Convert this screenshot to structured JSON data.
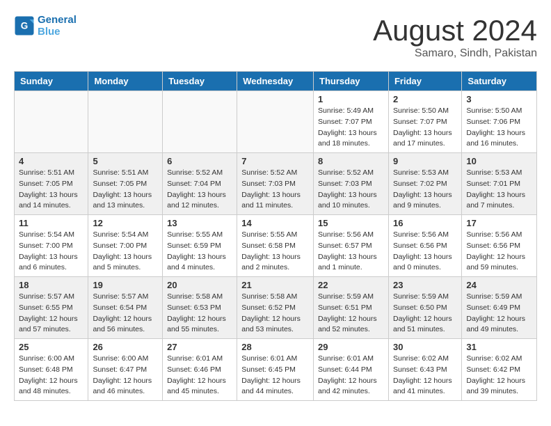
{
  "header": {
    "logo_line1": "General",
    "logo_line2": "Blue",
    "month_title": "August 2024",
    "location": "Samaro, Sindh, Pakistan"
  },
  "weekdays": [
    "Sunday",
    "Monday",
    "Tuesday",
    "Wednesday",
    "Thursday",
    "Friday",
    "Saturday"
  ],
  "weeks": [
    [
      {
        "day": "",
        "empty": true
      },
      {
        "day": "",
        "empty": true
      },
      {
        "day": "",
        "empty": true
      },
      {
        "day": "",
        "empty": true
      },
      {
        "day": "1",
        "sunrise": "5:49 AM",
        "sunset": "7:07 PM",
        "daylight": "13 hours and 18 minutes."
      },
      {
        "day": "2",
        "sunrise": "5:50 AM",
        "sunset": "7:07 PM",
        "daylight": "13 hours and 17 minutes."
      },
      {
        "day": "3",
        "sunrise": "5:50 AM",
        "sunset": "7:06 PM",
        "daylight": "13 hours and 16 minutes."
      }
    ],
    [
      {
        "day": "4",
        "sunrise": "5:51 AM",
        "sunset": "7:05 PM",
        "daylight": "13 hours and 14 minutes."
      },
      {
        "day": "5",
        "sunrise": "5:51 AM",
        "sunset": "7:05 PM",
        "daylight": "13 hours and 13 minutes."
      },
      {
        "day": "6",
        "sunrise": "5:52 AM",
        "sunset": "7:04 PM",
        "daylight": "13 hours and 12 minutes."
      },
      {
        "day": "7",
        "sunrise": "5:52 AM",
        "sunset": "7:03 PM",
        "daylight": "13 hours and 11 minutes."
      },
      {
        "day": "8",
        "sunrise": "5:52 AM",
        "sunset": "7:03 PM",
        "daylight": "13 hours and 10 minutes."
      },
      {
        "day": "9",
        "sunrise": "5:53 AM",
        "sunset": "7:02 PM",
        "daylight": "13 hours and 9 minutes."
      },
      {
        "day": "10",
        "sunrise": "5:53 AM",
        "sunset": "7:01 PM",
        "daylight": "13 hours and 7 minutes."
      }
    ],
    [
      {
        "day": "11",
        "sunrise": "5:54 AM",
        "sunset": "7:00 PM",
        "daylight": "13 hours and 6 minutes."
      },
      {
        "day": "12",
        "sunrise": "5:54 AM",
        "sunset": "7:00 PM",
        "daylight": "13 hours and 5 minutes."
      },
      {
        "day": "13",
        "sunrise": "5:55 AM",
        "sunset": "6:59 PM",
        "daylight": "13 hours and 4 minutes."
      },
      {
        "day": "14",
        "sunrise": "5:55 AM",
        "sunset": "6:58 PM",
        "daylight": "13 hours and 2 minutes."
      },
      {
        "day": "15",
        "sunrise": "5:56 AM",
        "sunset": "6:57 PM",
        "daylight": "13 hours and 1 minute."
      },
      {
        "day": "16",
        "sunrise": "5:56 AM",
        "sunset": "6:56 PM",
        "daylight": "13 hours and 0 minutes."
      },
      {
        "day": "17",
        "sunrise": "5:56 AM",
        "sunset": "6:56 PM",
        "daylight": "12 hours and 59 minutes."
      }
    ],
    [
      {
        "day": "18",
        "sunrise": "5:57 AM",
        "sunset": "6:55 PM",
        "daylight": "12 hours and 57 minutes."
      },
      {
        "day": "19",
        "sunrise": "5:57 AM",
        "sunset": "6:54 PM",
        "daylight": "12 hours and 56 minutes."
      },
      {
        "day": "20",
        "sunrise": "5:58 AM",
        "sunset": "6:53 PM",
        "daylight": "12 hours and 55 minutes."
      },
      {
        "day": "21",
        "sunrise": "5:58 AM",
        "sunset": "6:52 PM",
        "daylight": "12 hours and 53 minutes."
      },
      {
        "day": "22",
        "sunrise": "5:59 AM",
        "sunset": "6:51 PM",
        "daylight": "12 hours and 52 minutes."
      },
      {
        "day": "23",
        "sunrise": "5:59 AM",
        "sunset": "6:50 PM",
        "daylight": "12 hours and 51 minutes."
      },
      {
        "day": "24",
        "sunrise": "5:59 AM",
        "sunset": "6:49 PM",
        "daylight": "12 hours and 49 minutes."
      }
    ],
    [
      {
        "day": "25",
        "sunrise": "6:00 AM",
        "sunset": "6:48 PM",
        "daylight": "12 hours and 48 minutes."
      },
      {
        "day": "26",
        "sunrise": "6:00 AM",
        "sunset": "6:47 PM",
        "daylight": "12 hours and 46 minutes."
      },
      {
        "day": "27",
        "sunrise": "6:01 AM",
        "sunset": "6:46 PM",
        "daylight": "12 hours and 45 minutes."
      },
      {
        "day": "28",
        "sunrise": "6:01 AM",
        "sunset": "6:45 PM",
        "daylight": "12 hours and 44 minutes."
      },
      {
        "day": "29",
        "sunrise": "6:01 AM",
        "sunset": "6:44 PM",
        "daylight": "12 hours and 42 minutes."
      },
      {
        "day": "30",
        "sunrise": "6:02 AM",
        "sunset": "6:43 PM",
        "daylight": "12 hours and 41 minutes."
      },
      {
        "day": "31",
        "sunrise": "6:02 AM",
        "sunset": "6:42 PM",
        "daylight": "12 hours and 39 minutes."
      }
    ]
  ],
  "labels": {
    "sunrise": "Sunrise:",
    "sunset": "Sunset:",
    "daylight": "Daylight:"
  }
}
